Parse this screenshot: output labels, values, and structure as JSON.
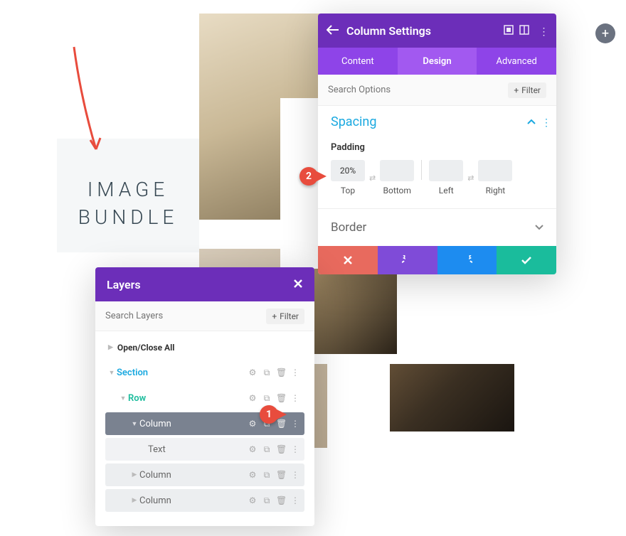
{
  "title": {
    "line1": "IMAGE",
    "line2": "BUNDLE"
  },
  "fab": {
    "plus": "+"
  },
  "settings": {
    "title": "Column Settings",
    "tabs": {
      "content": "Content",
      "design": "Design",
      "advanced": "Advanced"
    },
    "search_placeholder": "Search Options",
    "filter_label": "Filter",
    "spacing_label": "Spacing",
    "padding_label": "Padding",
    "padding": {
      "top_val": "20%",
      "bottom_val": "",
      "left_val": "",
      "right_val": "",
      "top": "Top",
      "bottom": "Bottom",
      "left": "Left",
      "right": "Right"
    },
    "border_label": "Border"
  },
  "layers": {
    "title": "Layers",
    "search_placeholder": "Search Layers",
    "filter_label": "Filter",
    "open_close": "Open/Close All",
    "items": {
      "section": "Section",
      "row": "Row",
      "column1": "Column",
      "text": "Text",
      "column2": "Column",
      "column3": "Column"
    }
  },
  "steps": {
    "one": "1",
    "two": "2"
  }
}
